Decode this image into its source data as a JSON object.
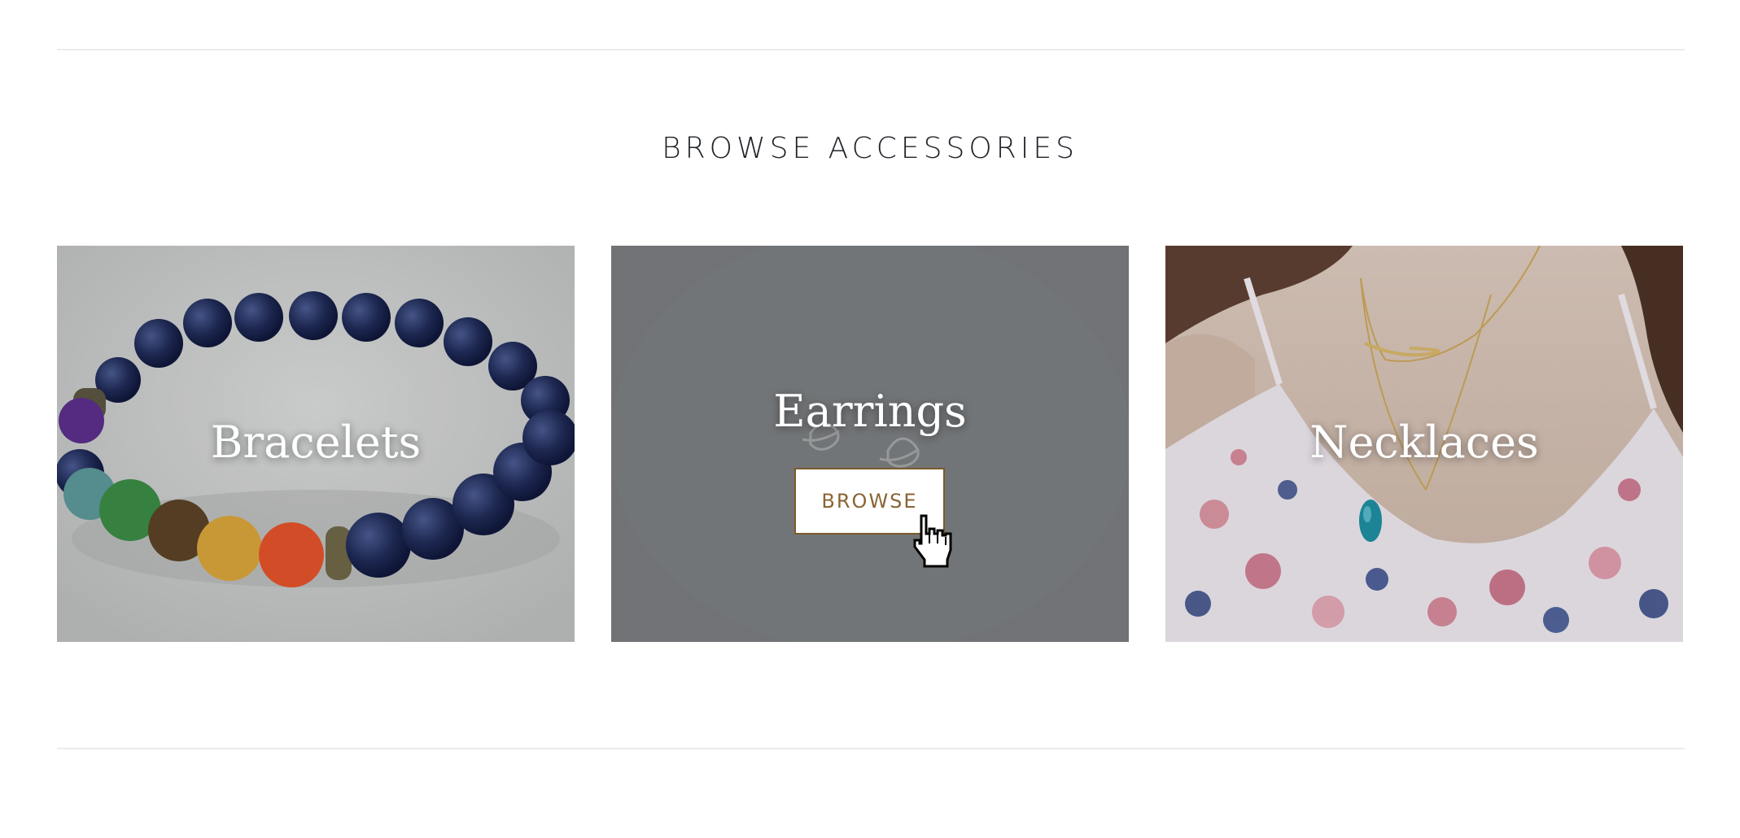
{
  "section": {
    "title": "BROWSE ACCESSORIES"
  },
  "tiles": [
    {
      "label": "Bracelets",
      "image": "beaded-bracelet-photo"
    },
    {
      "label": "Earrings",
      "image": "earrings-photo",
      "button_label": "BROWSE"
    },
    {
      "label": "Necklaces",
      "image": "necklace-photo"
    }
  ],
  "colors": {
    "button_border": "#7a5a2a",
    "button_text": "#8a6534",
    "title_text": "#1f2328"
  },
  "cursor": {
    "icon": "pointer-hand-icon"
  }
}
